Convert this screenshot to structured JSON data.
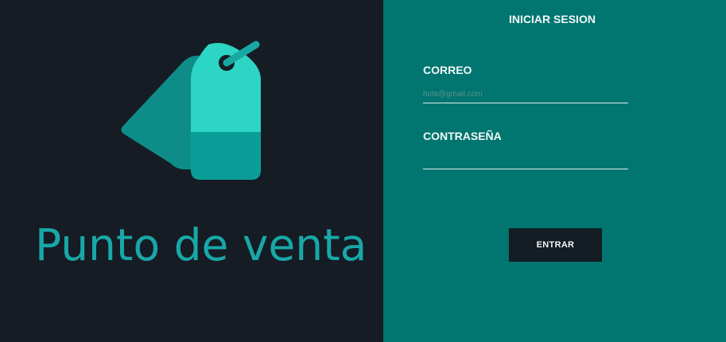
{
  "brand": {
    "name": "Punto de venta",
    "logo_icon": "price-tags-icon"
  },
  "login": {
    "title": "INICIAR SESION",
    "email_label": "CORREO",
    "email_placeholder": "hola@gmail.com",
    "email_value": "",
    "password_label": "CONTRASEÑA",
    "password_value": "",
    "submit_label": "ENTRAR"
  },
  "colors": {
    "left_background": "#151c24",
    "right_background": "#017570",
    "brand_text": "#19a7a8",
    "tag_light": "#2dd5c4",
    "tag_dark": "#0b9e99",
    "button_background": "#141c24"
  }
}
